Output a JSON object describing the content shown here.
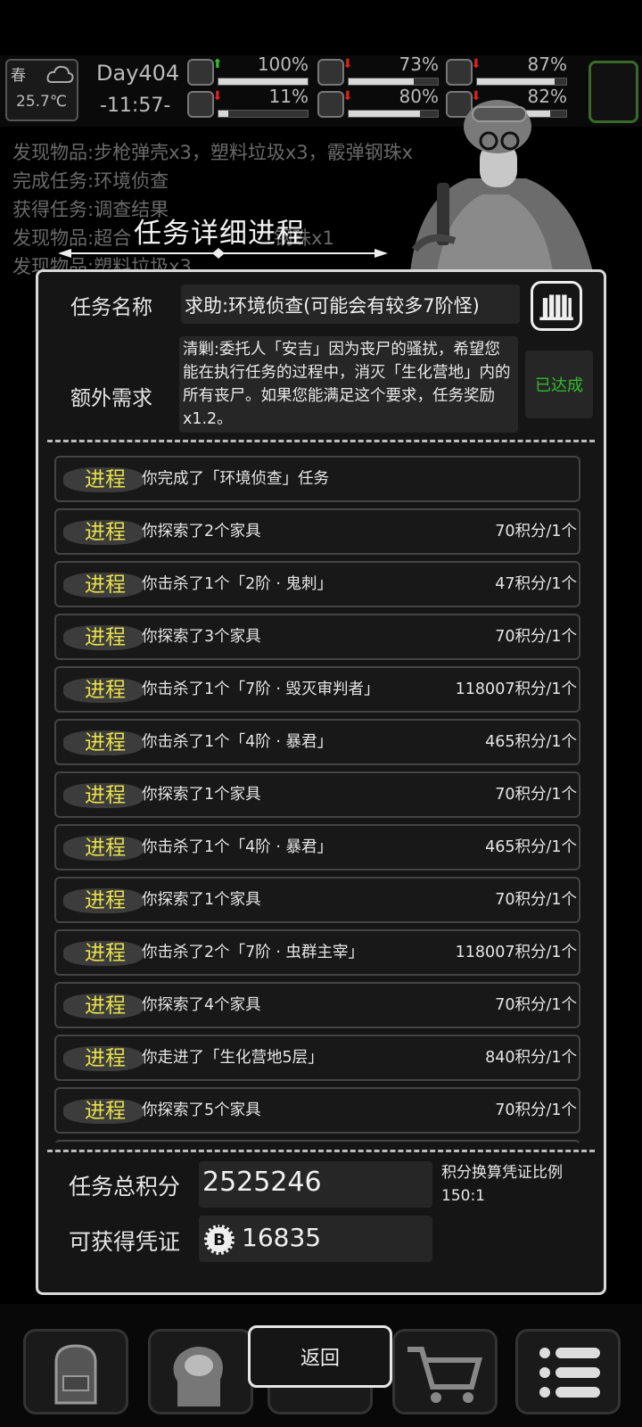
{
  "hud": {
    "season": "春",
    "temperature": "25.7℃",
    "day": "Day404",
    "time": "-11:57-",
    "stats": [
      {
        "name": "health",
        "icon": "medkit-icon",
        "trend": "up",
        "value": "100%",
        "level": 1.0
      },
      {
        "name": "hunger",
        "icon": "stomach-icon",
        "trend": "down",
        "value": "73%",
        "level": 0.73
      },
      {
        "name": "fatigue",
        "icon": "pill-icon",
        "trend": "down",
        "value": "87%",
        "level": 0.87
      },
      {
        "name": "infection",
        "icon": "boot-icon",
        "trend": "down",
        "value": "11%",
        "level": 0.11
      },
      {
        "name": "thirst",
        "icon": "water-drop-icon",
        "trend": "down",
        "value": "80%",
        "level": 0.8
      },
      {
        "name": "mood",
        "icon": "face-icon",
        "trend": "down",
        "value": "82%",
        "level": 0.82
      }
    ]
  },
  "log": [
    "发现物品:步枪弹壳x3，塑料垃圾x3，霰弹钢珠x",
    "完成任务:环境侦查",
    "获得任务:调查结果",
    "发现物品:超合",
    "发现物品:塑料垃圾x3"
  ],
  "log_fragment": "钢珠x1",
  "dialog": {
    "title": "任务详细进程",
    "task_name_label": "任务名称",
    "task_name": "求助:环境侦查(可能会有较多7阶怪)",
    "extra_label": "额外需求",
    "extra_text": "清剿:委托人「安吉」因为丧尸的骚扰，希望您能在执行任务的过程中，消灭「生化营地」内的所有丧尸。如果您能满足这个要求，任务奖励x1.2。",
    "extra_status": "已达成",
    "progress_tag": "进程",
    "rows": [
      {
        "desc": "你完成了「环境侦查」任务",
        "points": ""
      },
      {
        "desc": "你探索了2个家具",
        "points": "70积分/1个"
      },
      {
        "desc": "你击杀了1个「2阶 · 鬼刺」",
        "points": "47积分/1个"
      },
      {
        "desc": "你探索了3个家具",
        "points": "70积分/1个"
      },
      {
        "desc": "你击杀了1个「7阶 · 毁灭审判者」",
        "points": "118007积分/1个"
      },
      {
        "desc": "你击杀了1个「4阶 · 暴君」",
        "points": "465积分/1个"
      },
      {
        "desc": "你探索了1个家具",
        "points": "70积分/1个"
      },
      {
        "desc": "你击杀了1个「4阶 · 暴君」",
        "points": "465积分/1个"
      },
      {
        "desc": "你探索了1个家具",
        "points": "70积分/1个"
      },
      {
        "desc": "你击杀了2个「7阶 · 虫群主宰」",
        "points": "118007积分/1个"
      },
      {
        "desc": "你探索了4个家具",
        "points": "70积分/1个"
      },
      {
        "desc": "你走进了「生化营地5层」",
        "points": "840积分/1个"
      },
      {
        "desc": "你探索了5个家具",
        "points": "70积分/1个"
      }
    ],
    "total_label": "任务总积分",
    "total_value": "2525246",
    "ratio_label": "积分换算凭证比例",
    "ratio_value": "150:1",
    "voucher_label": "可获得凭证",
    "voucher_value": "16835",
    "coin_glyph": "B"
  },
  "bottom": {
    "back_label": "返回",
    "nav": [
      "backpack-icon",
      "brain-skill-icon",
      "shop-cart-icon",
      "menu-list-icon"
    ]
  }
}
